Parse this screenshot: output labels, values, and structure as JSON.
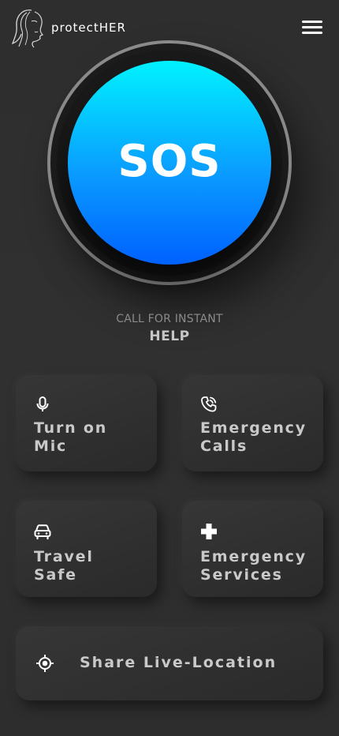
{
  "app": {
    "brand": "protectHER"
  },
  "header": {
    "logo_icon": "woman-profile-logo",
    "menu_icon": "hamburger-menu-icon"
  },
  "sos": {
    "label": "SOS",
    "gradient": [
      "#00f2ff",
      "#0061ff"
    ],
    "caption_small": "CALL FOR INSTANT",
    "caption_large": "HELP"
  },
  "actions": [
    {
      "id": "mic",
      "icon": "microphone-icon",
      "label": "Turn on\nMic"
    },
    {
      "id": "calls",
      "icon": "phone-ringing-icon",
      "label": "Emergency\nCalls"
    },
    {
      "id": "travel",
      "icon": "car-icon",
      "label": "Travel\nSafe"
    },
    {
      "id": "services",
      "icon": "medical-cross-icon",
      "label": "Emergency\nServices"
    },
    {
      "id": "location",
      "icon": "location-target-icon",
      "label": "Share Live-Location"
    }
  ],
  "colors": {
    "background": "#2f2f2f",
    "card_text": "#c9c9c9",
    "caption": "#8b8b8b"
  }
}
